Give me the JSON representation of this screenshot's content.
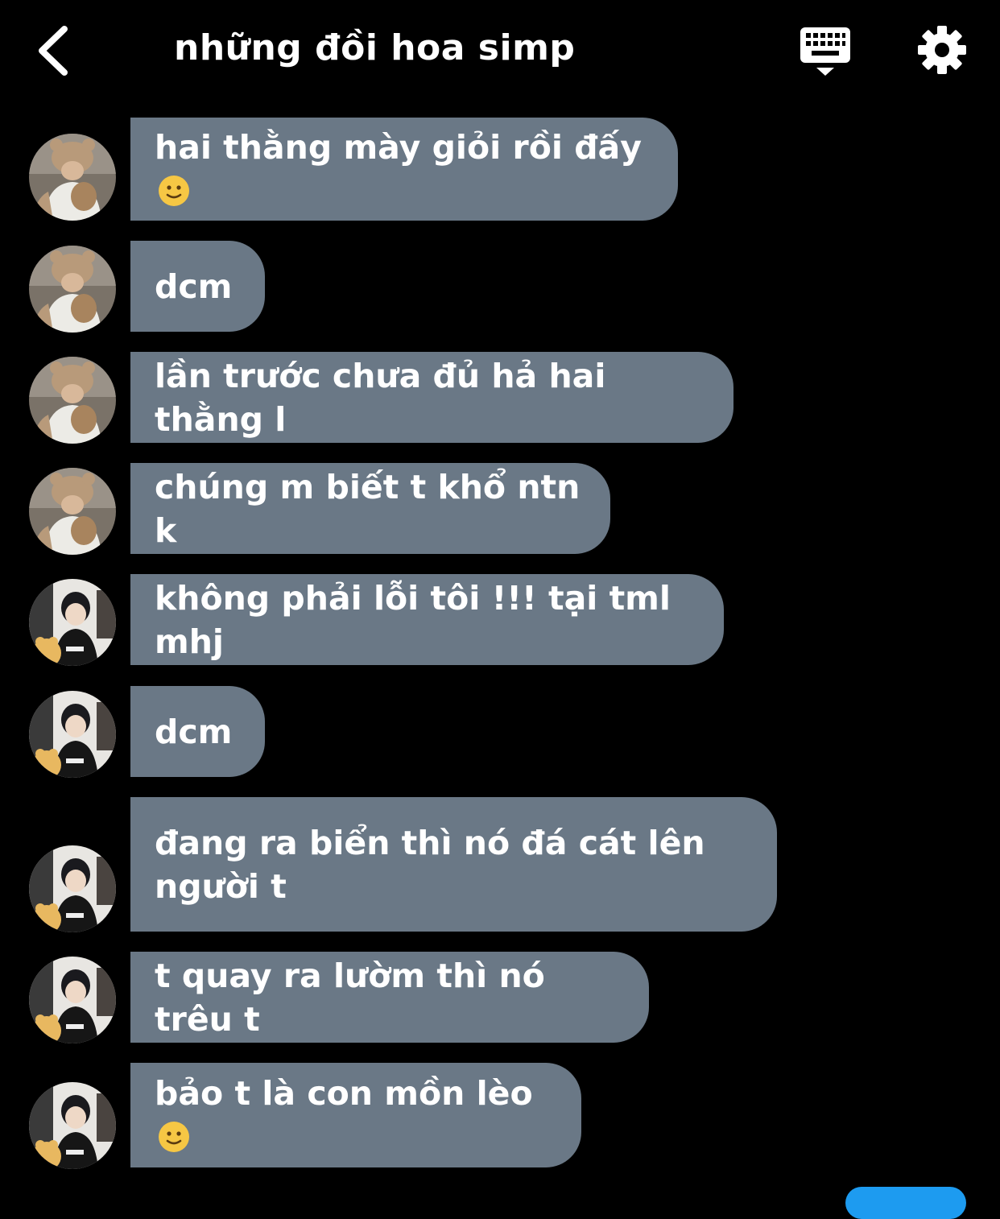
{
  "header": {
    "title": "những đồi hoa simp"
  },
  "colors": {
    "background": "#000000",
    "bubble": "#6a7886",
    "text": "#ffffff",
    "accent": "#1d9bf0"
  },
  "icons": {
    "back": "chevron-left-icon",
    "keyboard": "keyboard-icon",
    "settings": "gear-icon",
    "emoji": "slightly-smiling-face-emoji"
  },
  "messages": [
    {
      "sender": "user-a",
      "text": "hai thằng mày giỏi rồi đấy"
    },
    {
      "sender": "user-a",
      "text": "dcm"
    },
    {
      "sender": "user-a",
      "text": "lần trước chưa đủ hả hai thằng l"
    },
    {
      "sender": "user-a",
      "text": "chúng m biết t khổ ntn k"
    },
    {
      "sender": "user-b",
      "text": "không phải lỗi tôi !!! tại tml mhj"
    },
    {
      "sender": "user-b",
      "text": "dcm"
    },
    {
      "sender": "user-b",
      "text": "đang ra biển thì nó đá cát lên\nngười t"
    },
    {
      "sender": "user-b",
      "text": "t quay ra lườm thì nó trêu t"
    },
    {
      "sender": "user-b",
      "text": "bảo t là con mồn lèo"
    }
  ]
}
